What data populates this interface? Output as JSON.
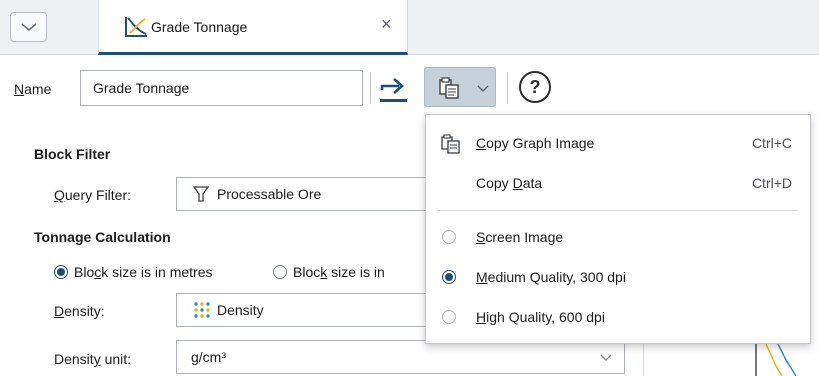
{
  "tab": {
    "title": "Grade Tonnage"
  },
  "toolbar": {
    "name_label": "Name",
    "name_value": "Grade Tonnage",
    "help_glyph": "?"
  },
  "block_filter": {
    "title": "Block Filter",
    "query_label": "Query Filter:",
    "query_value": "Processable Ore"
  },
  "tonnage": {
    "title": "Tonnage Calculation",
    "radio_metres": "Block size is in metres",
    "radio_other": "Block size is in",
    "density_label": "Density:",
    "density_value": "Density",
    "density_unit_label": "Density unit:",
    "density_unit_value": "g/cm³"
  },
  "menu": {
    "copy_image_label": "Copy Graph Image",
    "copy_image_shortcut": "Ctrl+C",
    "copy_data_label": "Copy Data",
    "copy_data_shortcut": "Ctrl+D",
    "options": [
      {
        "label": "Screen Image",
        "selected": false
      },
      {
        "label": "Medium Quality, 300 dpi",
        "selected": true
      },
      {
        "label": "High Quality, 600 dpi",
        "selected": false
      }
    ]
  },
  "colors": {
    "accent": "#1f4e79",
    "selected_button": "#c6d0db",
    "tab_icon": "#f2b100"
  }
}
